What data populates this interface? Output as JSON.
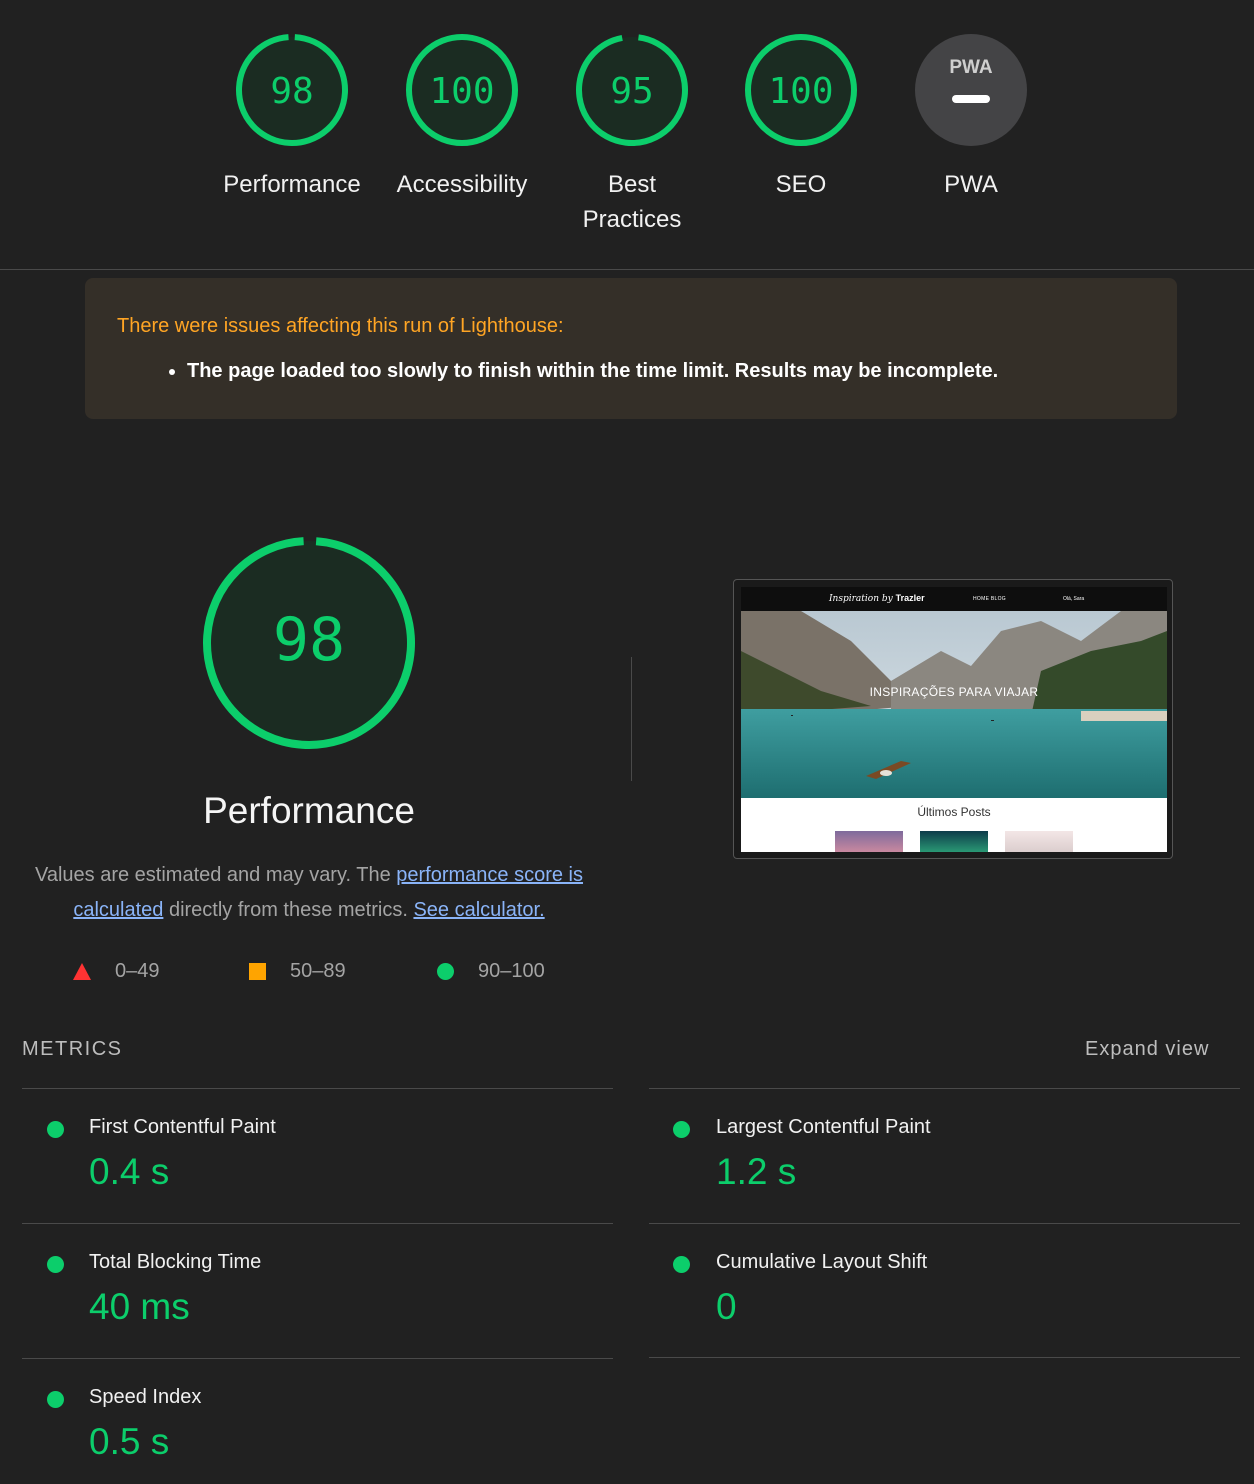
{
  "categories": [
    {
      "label": "Performance",
      "score": "98",
      "fraction": 0.98
    },
    {
      "label": "Accessibility",
      "score": "100",
      "fraction": 1.0
    },
    {
      "label": "Best Practices",
      "score": "95",
      "fraction": 0.95
    },
    {
      "label": "SEO",
      "score": "100",
      "fraction": 1.0
    },
    {
      "label": "PWA",
      "badge_text": "PWA"
    }
  ],
  "warning": {
    "title": "There were issues affecting this run of Lighthouse:",
    "items": [
      "The page loaded too slowly to finish within the time limit. Results may be incomplete."
    ]
  },
  "performance": {
    "score": "98",
    "fraction": 0.98,
    "title": "Performance",
    "desc_pre": "Values are estimated and may vary. The ",
    "link_score": "performance score is calculated",
    "desc_mid": " directly from these metrics. ",
    "link_calc": "See calculator."
  },
  "legend": {
    "fail": "0–49",
    "average": "50–89",
    "pass": "90–100"
  },
  "screenshot": {
    "logo_script": "Inspiration by",
    "logo_brand": "Trazler",
    "menu": "HOME   BLOG",
    "user": "Olá, Sara",
    "hero_text": "INSPIRAÇÕES PARA VIAJAR",
    "posts_heading": "Últimos Posts"
  },
  "metrics": {
    "heading": "METRICS",
    "expand": "Expand view",
    "items": [
      {
        "label": "First Contentful Paint",
        "value": "0.4 s"
      },
      {
        "label": "Largest Contentful Paint",
        "value": "1.2 s"
      },
      {
        "label": "Total Blocking Time",
        "value": "40 ms"
      },
      {
        "label": "Cumulative Layout Shift",
        "value": "0"
      },
      {
        "label": "Speed Index",
        "value": "0.5 s"
      }
    ]
  },
  "colors": {
    "pass": "#0cce6b",
    "average": "#ffa400",
    "fail": "#ff3333",
    "link": "#8ab4f8",
    "warning_title": "#ffa524"
  }
}
